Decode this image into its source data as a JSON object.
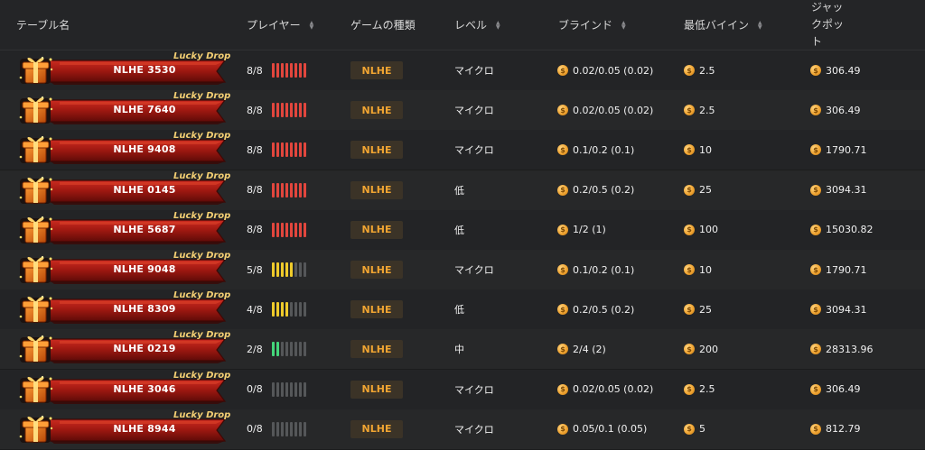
{
  "header": {
    "table_name": "テーブル名",
    "players": "プレイヤー",
    "game_type": "ゲームの種類",
    "level": "レベル",
    "blinds": "ブラインド",
    "min_buyin": "最低バイイン",
    "jackpot": "ジャックポット"
  },
  "banner_label": "Lucky Drop",
  "colors": {
    "full_bars": "#e2463d",
    "mid_bars": "#efcb2b",
    "low_bars": "#43d67a",
    "empty_bars": "#555759",
    "badge_text": "#f1a532",
    "badge_bg": "#3b3327"
  },
  "rows": [
    {
      "name": "NLHE 3530",
      "players": "8/8",
      "occupied": 8,
      "seats": 8,
      "game": "NLHE",
      "level": "マイクロ",
      "blinds": "0.02/0.05 (0.02)",
      "buyin": "2.5",
      "jackpot": "306.49",
      "bar_color": "#e2463d"
    },
    {
      "name": "NLHE 7640",
      "players": "8/8",
      "occupied": 8,
      "seats": 8,
      "game": "NLHE",
      "level": "マイクロ",
      "blinds": "0.02/0.05 (0.02)",
      "buyin": "2.5",
      "jackpot": "306.49",
      "bar_color": "#e2463d"
    },
    {
      "name": "NLHE 9408",
      "players": "8/8",
      "occupied": 8,
      "seats": 8,
      "game": "NLHE",
      "level": "マイクロ",
      "blinds": "0.1/0.2 (0.1)",
      "buyin": "10",
      "jackpot": "1790.71",
      "bar_color": "#e2463d"
    },
    {
      "name": "NLHE 0145",
      "players": "8/8",
      "occupied": 8,
      "seats": 8,
      "game": "NLHE",
      "level": "低",
      "blinds": "0.2/0.5 (0.2)",
      "buyin": "25",
      "jackpot": "3094.31",
      "bar_color": "#e2463d"
    },
    {
      "name": "NLHE 5687",
      "players": "8/8",
      "occupied": 8,
      "seats": 8,
      "game": "NLHE",
      "level": "低",
      "blinds": "1/2 (1)",
      "buyin": "100",
      "jackpot": "15030.82",
      "bar_color": "#e2463d"
    },
    {
      "name": "NLHE 9048",
      "players": "5/8",
      "occupied": 5,
      "seats": 8,
      "game": "NLHE",
      "level": "マイクロ",
      "blinds": "0.1/0.2 (0.1)",
      "buyin": "10",
      "jackpot": "1790.71",
      "bar_color": "#efcb2b"
    },
    {
      "name": "NLHE 8309",
      "players": "4/8",
      "occupied": 4,
      "seats": 8,
      "game": "NLHE",
      "level": "低",
      "blinds": "0.2/0.5 (0.2)",
      "buyin": "25",
      "jackpot": "3094.31",
      "bar_color": "#efcb2b"
    },
    {
      "name": "NLHE 0219",
      "players": "2/8",
      "occupied": 2,
      "seats": 8,
      "game": "NLHE",
      "level": "中",
      "blinds": "2/4 (2)",
      "buyin": "200",
      "jackpot": "28313.96",
      "bar_color": "#43d67a"
    },
    {
      "name": "NLHE 3046",
      "players": "0/8",
      "occupied": 0,
      "seats": 8,
      "game": "NLHE",
      "level": "マイクロ",
      "blinds": "0.02/0.05 (0.02)",
      "buyin": "2.5",
      "jackpot": "306.49",
      "bar_color": "#555759"
    },
    {
      "name": "NLHE 8944",
      "players": "0/8",
      "occupied": 0,
      "seats": 8,
      "game": "NLHE",
      "level": "マイクロ",
      "blinds": "0.05/0.1 (0.05)",
      "buyin": "5",
      "jackpot": "812.79",
      "bar_color": "#555759"
    }
  ]
}
